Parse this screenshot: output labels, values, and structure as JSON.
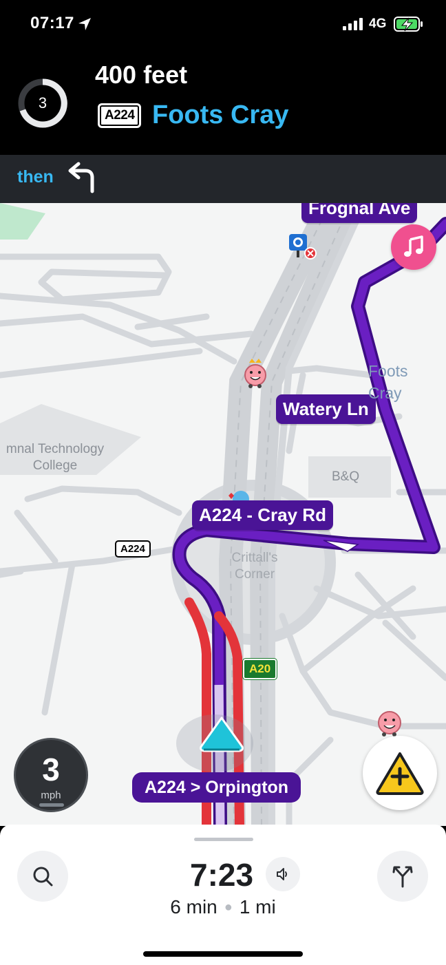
{
  "status_bar": {
    "time": "07:17",
    "network": "4G",
    "icons": [
      "location-arrow-icon",
      "signal-bars-icon",
      "battery-charging-icon"
    ]
  },
  "instruction": {
    "countdown": "3",
    "distance": "400 feet",
    "road_shield": "A224",
    "street": "Foots Cray",
    "icon": "turn-left-icon"
  },
  "then": {
    "label": "then",
    "icon": "turn-left-icon"
  },
  "map": {
    "road_labels": {
      "frognal": "Frognal Ave",
      "watery": "Watery Ln",
      "cray_rd": "A224 - Cray Rd"
    },
    "area_labels": {
      "foots_cray": "Foots\nCray",
      "college": "mnal Technology\nCollege",
      "bq": "B&Q",
      "crittalls": "Crittall's\nCorner"
    },
    "shields": {
      "a224": "A224",
      "a20": "A20"
    },
    "colors": {
      "route": "#6a1fc2",
      "traffic": "#e3343a",
      "road": "#d4d7db",
      "accent": "#38b8f2"
    }
  },
  "speed": {
    "value": "3",
    "unit": "mph"
  },
  "current_road": "A224 > Orpington",
  "eta": {
    "arrival": "7:23",
    "duration": "6 min",
    "distance": "1 mi"
  },
  "buttons": {
    "search_icon": "search-icon",
    "sound_icon": "speaker-icon",
    "routes_icon": "route-fork-icon",
    "report_icon": "hazard-report-icon",
    "music_icon": "music-note-icon"
  }
}
